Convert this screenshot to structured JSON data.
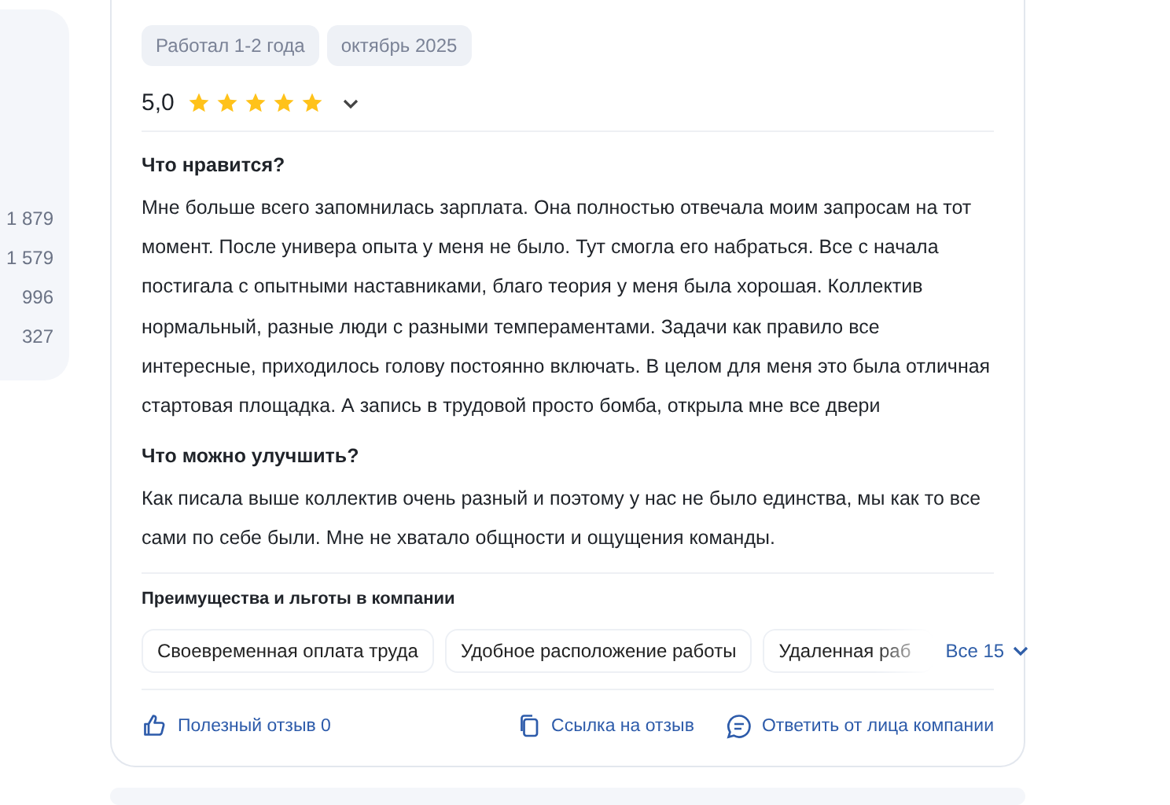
{
  "sidebar": {
    "counts": [
      "1 879",
      "1 579",
      "996",
      "327"
    ]
  },
  "review": {
    "tags": [
      "Работал 1-2 года",
      "октябрь 2025"
    ],
    "rating": {
      "value": "5,0",
      "stars": 5
    },
    "sections": [
      {
        "title": "Что нравится?",
        "text": "Мне больше всего запомнилась зарплата. Она полностью отвечала моим запросам на тот момент. После универа опыта у меня не было. Тут смогла его набраться. Все с начала постигала с опытными наставниками, благо теория у меня была хорошая. Коллектив нормальный, разные люди с разными темпераментами. Задачи как правило все интересные, приходилось голову постоянно включать. В целом для меня это была отличная стартовая площадка. А запись в трудовой просто бомба, открыла мне все двери"
      },
      {
        "title": "Что можно улучшить?",
        "text": "Как писала выше коллектив очень разный и поэтому у нас не было единства, мы как то все сами по себе были. Мне не хватало общности и ощущения команды."
      }
    ],
    "benefits": {
      "title": "Преимущества и льготы в компании",
      "items": [
        "Своевременная оплата труда",
        "Удобное расположение работы",
        "Удаленная раб"
      ],
      "more": "Все 15"
    },
    "actions": [
      {
        "kind": "like",
        "label": "Полезный отзыв 0"
      },
      {
        "kind": "link",
        "label": "Ссылка на отзыв"
      },
      {
        "kind": "reply",
        "label": "Ответить от лица компании"
      }
    ]
  }
}
